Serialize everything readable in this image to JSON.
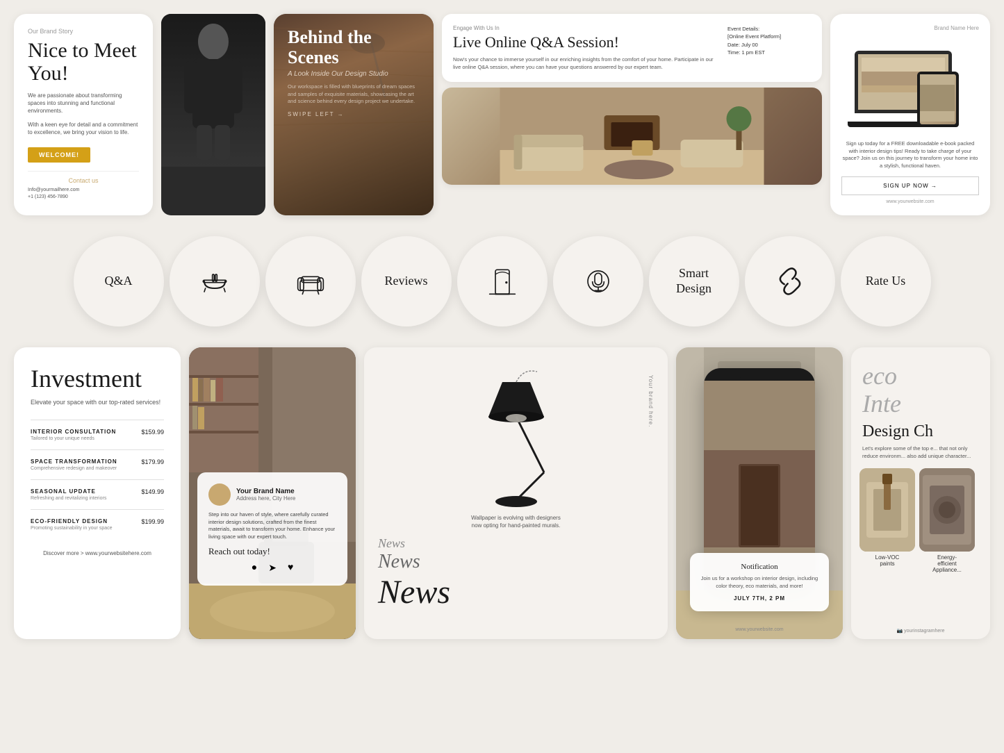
{
  "row1": {
    "card_meet": {
      "brand_story": "Our Brand Story",
      "headline": "Nice to Meet You!",
      "body1": "We are passionate about transforming spaces into stunning and functional environments.",
      "body2": "With a keen eye for detail and a commitment to excellence, we bring your vision to life.",
      "welcome_btn": "WELCOME!",
      "contact_label": "Contact us",
      "email": "Info@yourmailhere.com",
      "phone": "+1 (123) 456-7890"
    },
    "card_behind": {
      "heading": "Behind the Scenes",
      "subtitle": "A Look Inside Our Design Studio",
      "body": "Our workspace is filled with blueprints of dream spaces and samples of exquisite materials, showcasing the art and science behind every design project we undertake.",
      "swipe": "SWIPE LEFT →"
    },
    "card_qa": {
      "engage": "Engage With Us In",
      "title": "Live Online Q&A Session!",
      "body": "Now's your chance to immerse yourself in our enriching insights from the comfort of your home. Participate in our live online Q&A session, where you can have your questions answered by our expert team.",
      "event_details": "Event Details:",
      "event_platform": "[Online Event Platform]",
      "event_date": "Date: July 00",
      "event_time": "Time: 1 pm EST"
    },
    "card_device": {
      "brand_name": "Brand Name Here",
      "body": "Sign up today for a FREE downloadable e-book packed with interior design tips! Ready to take charge of your space? Join us on this journey to transform your home into a stylish, functional haven.",
      "signup_btn": "SIGN UP NOW →",
      "website": "www.yourwebsite.com"
    }
  },
  "row2": {
    "circles": [
      {
        "id": "qa",
        "label": "Q&A",
        "icon_type": "text"
      },
      {
        "id": "bathtub",
        "label": "",
        "icon_type": "bathtub"
      },
      {
        "id": "sofa",
        "label": "",
        "icon_type": "sofa"
      },
      {
        "id": "reviews",
        "label": "Reviews",
        "icon_type": "text"
      },
      {
        "id": "door",
        "label": "",
        "icon_type": "door"
      },
      {
        "id": "mic",
        "label": "",
        "icon_type": "mic"
      },
      {
        "id": "smart_design",
        "label": "Smart\nDesign",
        "icon_type": "text"
      },
      {
        "id": "link",
        "label": "",
        "icon_type": "link"
      },
      {
        "id": "rate_us",
        "label": "Rate Us",
        "icon_type": "text"
      }
    ]
  },
  "row3": {
    "card_investment": {
      "title": "Investment",
      "subtitle": "Elevate your space with our top-rated services!",
      "items": [
        {
          "label": "INTERIOR CONSULTATION",
          "desc": "Tailored to your unique needs",
          "price": "$159.99"
        },
        {
          "label": "SPACE TRANSFORMATION",
          "desc": "Comprehensive redesign and makeover",
          "price": "$179.99"
        },
        {
          "label": "SEASONAL UPDATE",
          "desc": "Refreshing and revitalizing interiors",
          "price": "$149.99"
        },
        {
          "label": "ECO-FRIENDLY DESIGN",
          "desc": "Promoting sustainability in your space",
          "price": "$199.99"
        }
      ],
      "discover": "Discover more > www.yourwebsitehere.com"
    },
    "card_brand": {
      "brand_name": "Your Brand Name",
      "address": "Address here, City Here",
      "body": "Step into our haven of style, where carefully curated interior design solutions, crafted from the finest materials, await to transform your home. Enhance your living space with our expert touch.",
      "reach_out": "Reach out today!"
    },
    "card_lamp": {
      "brand_vertical": "Your brand\nhere.",
      "wallpaper_text": "Wallpaper is evolving with designers now opting for hand-painted murals.",
      "news_small": "News",
      "news_medium": "News",
      "news_large": "News"
    },
    "card_phone": {
      "notification": {
        "title": "Notification",
        "body": "Join us for a workshop on interior design, including color theory, eco materials, and more!",
        "date": "JULY 7TH, 2 PM"
      },
      "website": "www.yourwebsite.com"
    },
    "card_eco": {
      "title_line1": "eco",
      "title_line2": "Inte",
      "heading": "Design Ch",
      "body": "Let's explore some of the top e... that not only reduce environm... also add unique character...",
      "photos": [
        {
          "label": "Low-VOC\npaints"
        },
        {
          "label": "Energy-\nefficient\nAppliance..."
        }
      ],
      "instagram": "yourinstagramhere"
    }
  }
}
